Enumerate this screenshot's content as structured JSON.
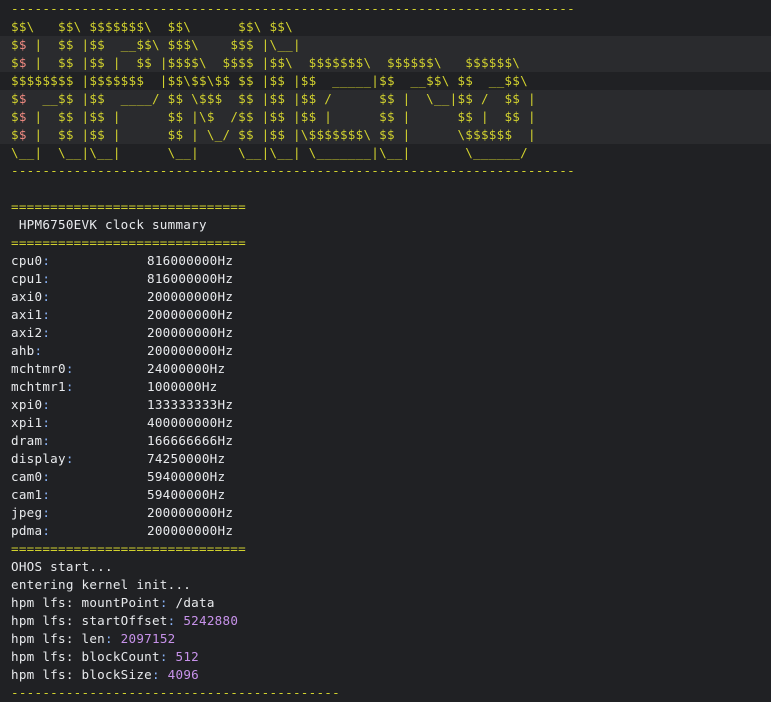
{
  "terminal": {
    "top_rule": "------------------------------------------------------------------------",
    "banner": [
      "$$\\   $$\\ $$$$$$$\\  $$\\      $$\\ $$\\",
      "$$ |  $$ |$$  __$$\\ $$$\\    $$$ |\\__|",
      "$$ |  $$ |$$ |  $$ |$$$$\\  $$$$ |$$\\  $$$$$$$\\  $$$$$$\\   $$$$$$\\",
      "$$$$$$$$ |$$$$$$$  |$$\\$$\\$$ $$ |$$ |$$  _____|$$  __$$\\ $$  __$$\\",
      "$$  __$$ |$$  ____/ $$ \\$$$  $$ |$$ |$$ /      $$ |  \\__|$$ /  $$ |",
      "$$ |  $$ |$$ |      $$ |\\$  /$$ |$$ |$$ |      $$ |      $$ |  $$ |",
      "$$ |  $$ |$$ |      $$ | \\_/ $$ |$$ |\\$$$$$$$\\ $$ |      \\$$$$$$  |",
      "\\__|  \\__|\\__|      \\__|     \\__|\\__| \\_______|\\__|       \\______/"
    ],
    "bottom_rule": "------------------------------------------------------------------------",
    "summary_rule_top": "==============================",
    "summary_title": " HPM6750EVK clock summary",
    "summary_rule_mid": "==============================",
    "clocks": [
      {
        "name": "cpu0",
        "value": "816000000Hz"
      },
      {
        "name": "cpu1",
        "value": "816000000Hz"
      },
      {
        "name": "axi0",
        "value": "200000000Hz"
      },
      {
        "name": "axi1",
        "value": "200000000Hz"
      },
      {
        "name": "axi2",
        "value": "200000000Hz"
      },
      {
        "name": "ahb",
        "value": "200000000Hz"
      },
      {
        "name": "mchtmr0",
        "value": "24000000Hz"
      },
      {
        "name": "mchtmr1",
        "value": "1000000Hz"
      },
      {
        "name": "xpi0",
        "value": "133333333Hz"
      },
      {
        "name": "xpi1",
        "value": "400000000Hz"
      },
      {
        "name": "dram",
        "value": "166666666Hz"
      },
      {
        "name": "display",
        "value": "74250000Hz"
      },
      {
        "name": "cam0",
        "value": "59400000Hz"
      },
      {
        "name": "cam1",
        "value": "59400000Hz"
      },
      {
        "name": "jpeg",
        "value": "200000000Hz"
      },
      {
        "name": "pdma",
        "value": "200000000Hz"
      }
    ],
    "summary_rule_bottom": "==============================",
    "boot": [
      {
        "text": "OHOS start..."
      },
      {
        "text": "entering kernel init..."
      }
    ],
    "lfs": [
      {
        "prefix": "hpm lfs: mountPoint",
        "value": "/data",
        "numeric": false
      },
      {
        "prefix": "hpm lfs: startOffset",
        "value": "5242880",
        "numeric": true
      },
      {
        "prefix": "hpm lfs: len",
        "value": "2097152",
        "numeric": true
      },
      {
        "prefix": "hpm lfs: blockCount",
        "value": "512",
        "numeric": true
      },
      {
        "prefix": "hpm lfs: blockSize",
        "value": "4096",
        "numeric": true
      }
    ],
    "final_rule": "------------------------------------------",
    "colors": {
      "background": "#202124",
      "banner": "#d2d22e",
      "text": "#e8eaed",
      "number": "#c792ea",
      "colon": "#8ab4f8"
    }
  }
}
